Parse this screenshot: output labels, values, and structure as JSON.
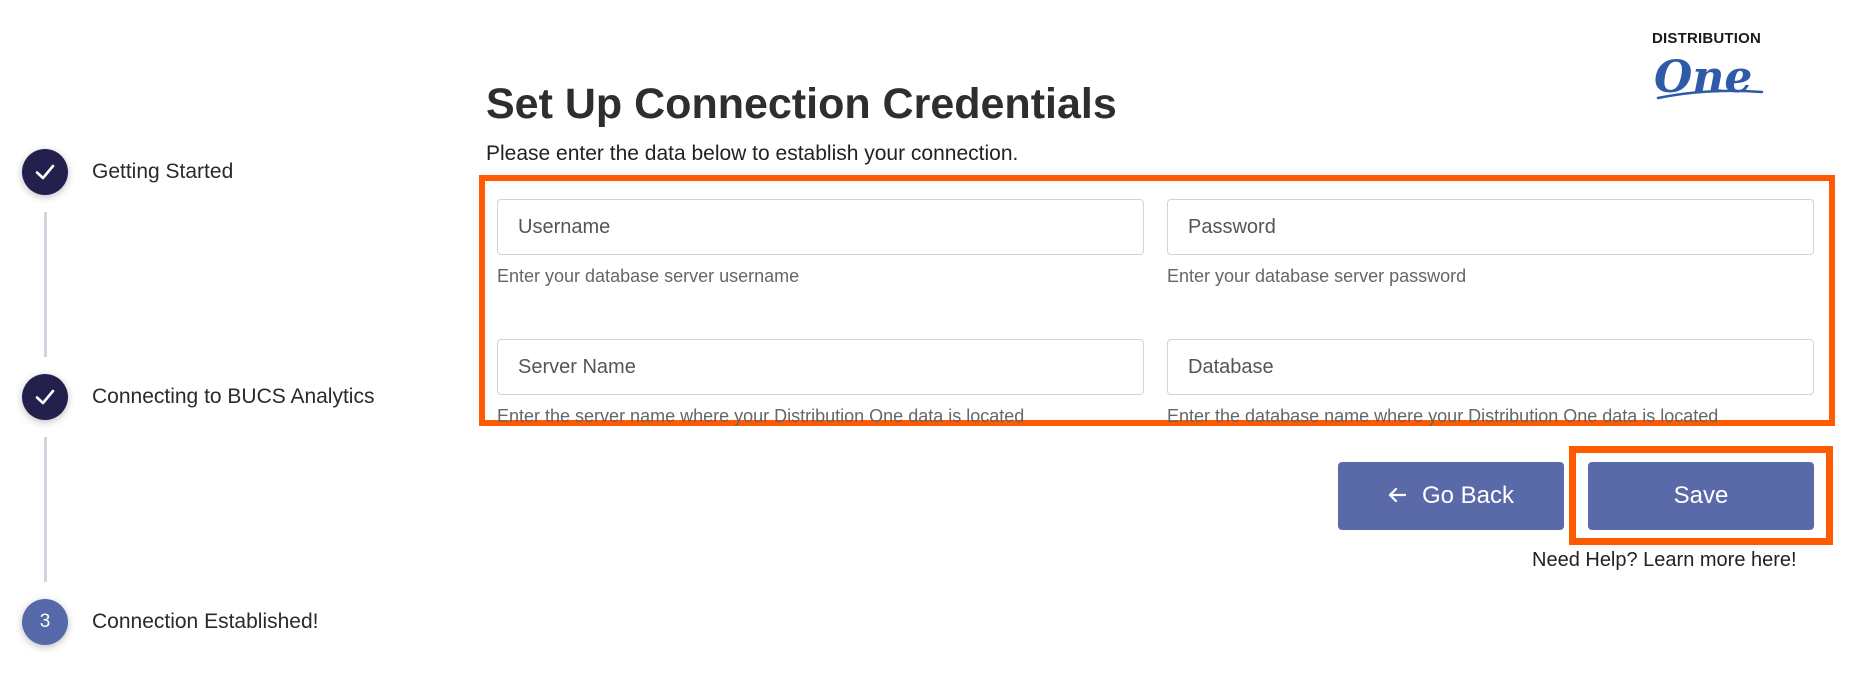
{
  "stepper": {
    "steps": [
      {
        "label": "Getting Started",
        "status": "complete"
      },
      {
        "label": "Connecting to BUCS Analytics",
        "status": "complete"
      },
      {
        "label": "Connection Established!",
        "status": "pending",
        "number": "3"
      }
    ]
  },
  "header": {
    "title": "Set Up Connection Credentials",
    "subtitle": "Please enter the data below to establish your connection."
  },
  "form": {
    "username": {
      "placeholder": "Username",
      "value": "",
      "help": "Enter your database server username"
    },
    "password": {
      "placeholder": "Password",
      "value": "",
      "help": "Enter your database server password"
    },
    "server": {
      "placeholder": "Server Name",
      "value": "",
      "help": "Enter the server name where your Distribution One data is located"
    },
    "database": {
      "placeholder": "Database",
      "value": "",
      "help": "Enter the database name where your Distribution One data is located"
    }
  },
  "actions": {
    "back_label": "Go Back",
    "back_icon": "arrow-left-icon",
    "save_label": "Save",
    "help_link": "Need Help? Learn more here!"
  },
  "logo": {
    "line1": "DISTRIBUTION",
    "line2": "One"
  },
  "colors": {
    "primary": "#5a6aa8",
    "step_done": "#24204d",
    "highlight": "#ff5a00",
    "logo_blue": "#2f5aa8"
  }
}
